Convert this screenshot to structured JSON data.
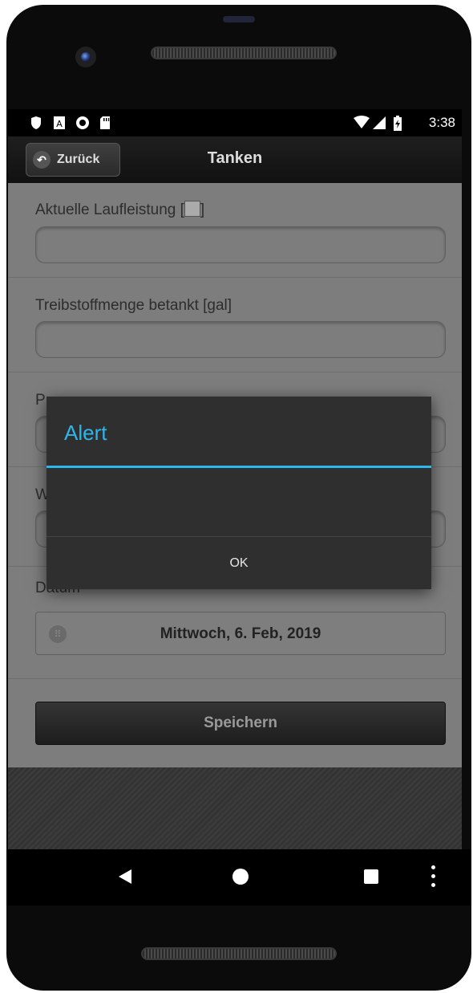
{
  "status_bar": {
    "time": "3:38",
    "left_icons": [
      "shield-icon",
      "a-badge-icon",
      "record-icon",
      "sd-card-icon"
    ],
    "right_icons": [
      "wifi-icon",
      "signal-icon",
      "battery-charging-icon"
    ]
  },
  "header": {
    "back_label": "Zurück",
    "title": "Tanken"
  },
  "form": {
    "mileage_label": "Aktuelle Laufleistung [",
    "mileage_label_end": "]",
    "mileage_value": "",
    "fuel_label": "Treibstoffmenge betankt [gal]",
    "fuel_value": "",
    "price_label": "P",
    "price_value": "",
    "w_label": "W",
    "w_value": "",
    "date_label": "Datum",
    "date_value": "Mittwoch, 6. Feb, 2019",
    "save_label": "Speichern"
  },
  "dialog": {
    "title": "Alert",
    "message": "",
    "ok_label": "OK"
  },
  "colors": {
    "accent": "#2db6ea",
    "dialog_bg": "#2f2f2f",
    "overlay_content": "#7d7d7d"
  }
}
